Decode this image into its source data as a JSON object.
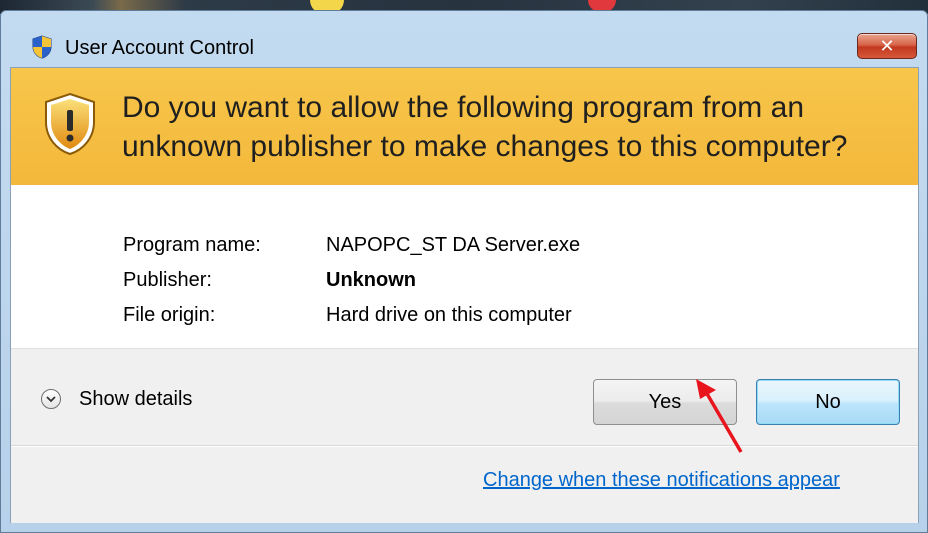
{
  "window": {
    "title": "User Account Control",
    "close_label": "✕"
  },
  "banner": {
    "question": "Do you want to allow the following program from an unknown publisher to make changes to this computer?"
  },
  "info": {
    "rows": [
      {
        "label": "Program name:",
        "value": "NAPOPC_ST DA Server.exe",
        "bold": false
      },
      {
        "label": "Publisher:",
        "value": "Unknown",
        "bold": true
      },
      {
        "label": "File origin:",
        "value": "Hard drive on this computer",
        "bold": false
      }
    ]
  },
  "footer": {
    "details_label": "Show details",
    "yes_label": "Yes",
    "no_label": "No",
    "link_label": "Change when these notifications appear"
  },
  "icons": {
    "title": "uac-shield-icon",
    "banner": "warning-shield-icon",
    "details": "chevron-down-icon",
    "annotation": "red-arrow-icon"
  },
  "colors": {
    "banner": "#f3b83b",
    "link": "#0066cc",
    "close_button": "#c2381f",
    "annotation_arrow": "#e8151d"
  }
}
